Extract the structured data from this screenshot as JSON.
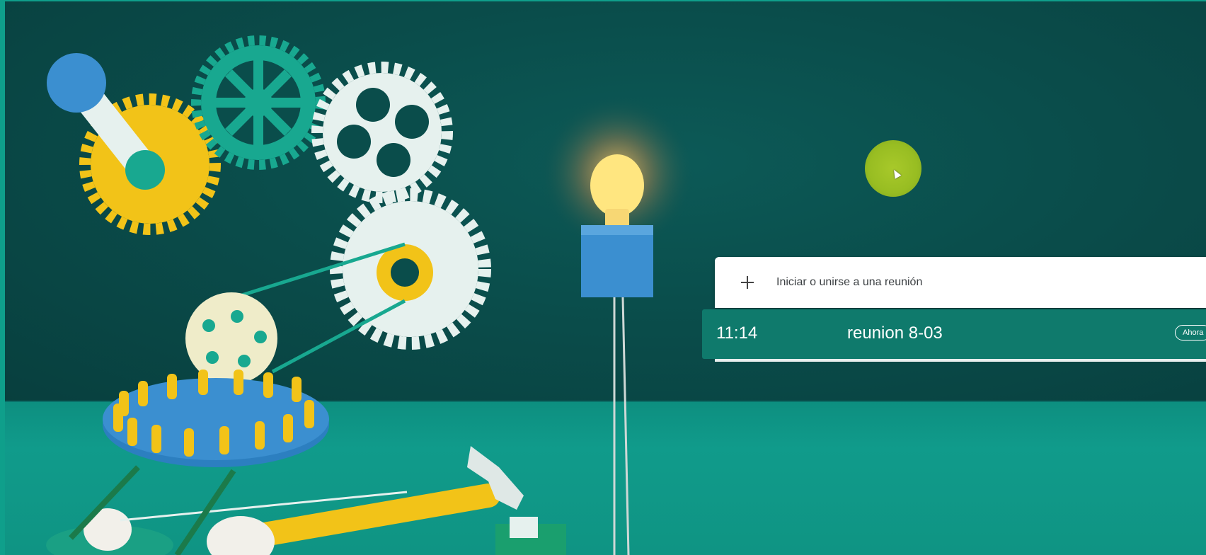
{
  "meeting_panel": {
    "join_label": "Iniciar o unirse a una reunión",
    "meeting": {
      "time": "11:14",
      "title": "reunion 8-03",
      "status_badge": "Ahora"
    }
  },
  "colors": {
    "wall": "#0a4d4b",
    "floor": "#109b8b",
    "row_highlight": "#0f7a6c",
    "cursor_highlight": "#a8c92a",
    "gear_yellow": "#f2c318",
    "gear_teal": "#18a890",
    "gear_light": "#e6f1ee",
    "blue": "#3b8fd0",
    "bulb": "#ffe680"
  },
  "icons": [
    "plus-icon",
    "cursor-icon"
  ]
}
